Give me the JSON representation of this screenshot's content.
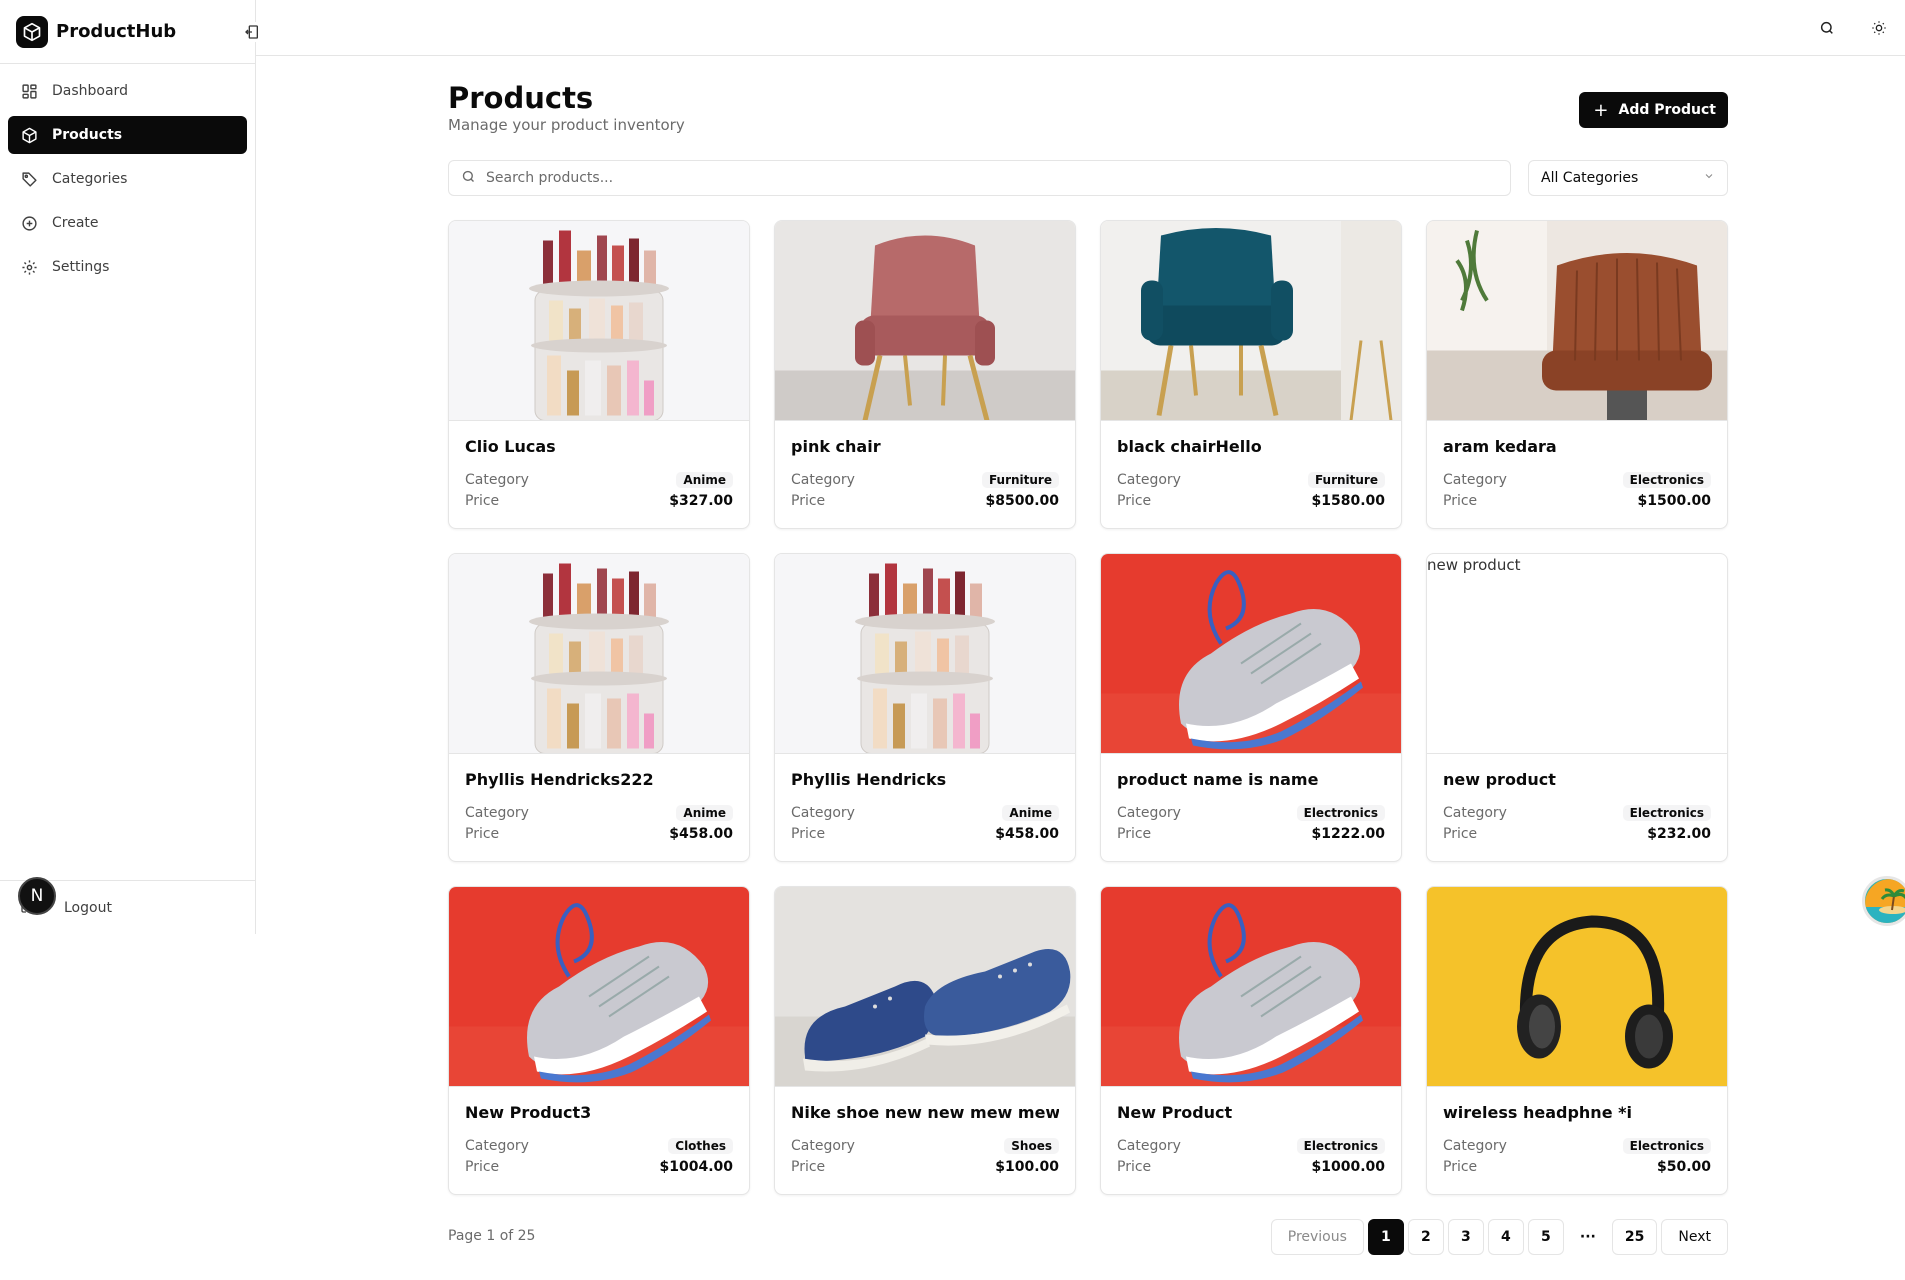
{
  "app": {
    "name": "ProductHub"
  },
  "sidebar": {
    "items": [
      {
        "label": "Dashboard",
        "icon": "dashboard-icon"
      },
      {
        "label": "Products",
        "icon": "package-icon",
        "active": true
      },
      {
        "label": "Categories",
        "icon": "tag-icon"
      },
      {
        "label": "Create",
        "icon": "plus-circle-icon"
      },
      {
        "label": "Settings",
        "icon": "gear-icon"
      }
    ],
    "logout_label": "Logout",
    "avatar_initial": "N"
  },
  "header": {
    "title": "Products",
    "subtitle": "Manage your product inventory",
    "add_button_label": "Add Product"
  },
  "filters": {
    "search_placeholder": "Search products...",
    "category_selected": "All Categories"
  },
  "card_labels": {
    "category": "Category",
    "price": "Price"
  },
  "products": [
    {
      "name": "Clio Lucas",
      "category": "Anime",
      "price": "$327.00",
      "image": "organizer"
    },
    {
      "name": "pink chair",
      "category": "Furniture",
      "price": "$8500.00",
      "image": "pink-chair"
    },
    {
      "name": "black chairHello",
      "category": "Furniture",
      "price": "$1580.00",
      "image": "teal-chair"
    },
    {
      "name": "aram kedara",
      "category": "Electronics",
      "price": "$1500.00",
      "image": "brown-chair"
    },
    {
      "name": "Phyllis Hendricks222",
      "category": "Anime",
      "price": "$458.00",
      "image": "organizer"
    },
    {
      "name": "Phyllis Hendricks",
      "category": "Anime",
      "price": "$458.00",
      "image": "organizer"
    },
    {
      "name": "product name is name",
      "category": "Electronics",
      "price": "$1222.00",
      "image": "sneaker-red"
    },
    {
      "name": "new product",
      "category": "Electronics",
      "price": "$232.00",
      "image": "broken",
      "alt": "new product"
    },
    {
      "name": "New Product3",
      "category": "Clothes",
      "price": "$1004.00",
      "image": "sneaker-red"
    },
    {
      "name": "Nike shoe new new mew mew",
      "category": "Shoes",
      "price": "$100.00",
      "image": "blue-shoe"
    },
    {
      "name": "New Product",
      "category": "Electronics",
      "price": "$1000.00",
      "image": "sneaker-red"
    },
    {
      "name": "wireless headphne *i",
      "category": "Electronics",
      "price": "$50.00",
      "image": "headphones"
    }
  ],
  "pagination": {
    "info": "Page 1 of 25",
    "previous": "Previous",
    "pages": [
      "1",
      "2",
      "3",
      "4",
      "5"
    ],
    "ellipsis": "···",
    "last": "25",
    "next": "Next",
    "current": "1"
  },
  "colors": {
    "primary": "#0a0a0a",
    "border": "#e5e5e5",
    "muted": "#6b6b6b"
  }
}
